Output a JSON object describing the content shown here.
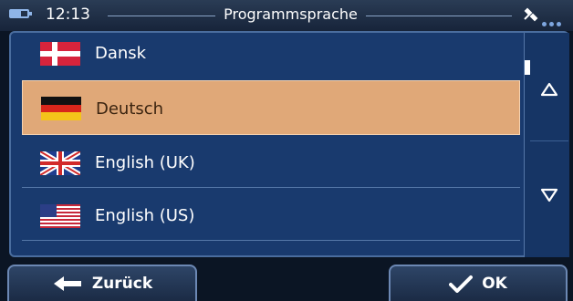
{
  "status": {
    "time": "12:13",
    "title": "Programmsprache"
  },
  "languages": [
    {
      "label": "Dansk",
      "flag": "denmark-flag-icon",
      "selected": false
    },
    {
      "label": "Deutsch",
      "flag": "germany-flag-icon",
      "selected": true
    },
    {
      "label": "English (UK)",
      "flag": "uk-flag-icon",
      "selected": false
    },
    {
      "label": "English (US)",
      "flag": "us-flag-icon",
      "selected": false
    }
  ],
  "buttons": {
    "back_label": "Zurück",
    "ok_label": "OK"
  },
  "colors": {
    "panel": "#193a6e",
    "selected_row": "#e0a878",
    "background": "#0b1524"
  }
}
